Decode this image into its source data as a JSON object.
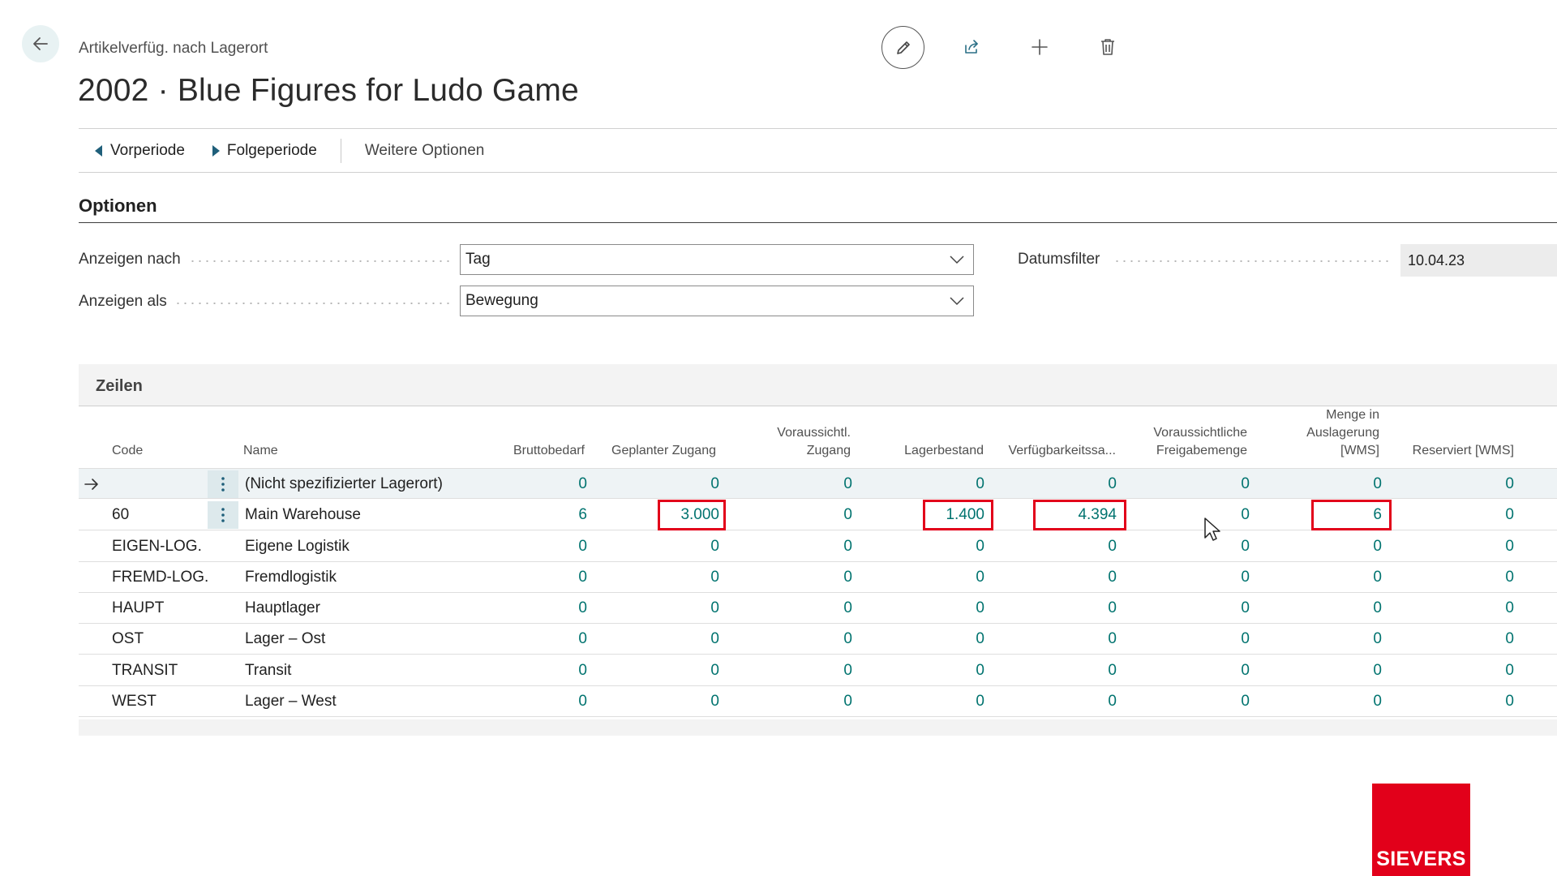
{
  "header": {
    "caption": "Artikelverfüg. nach Lagerort",
    "title": "2002 · Blue Figures for Ludo Game",
    "toolbar_icons": [
      "edit-icon",
      "share-icon",
      "plus-icon",
      "trash-icon"
    ]
  },
  "actions": {
    "prev_label": "Vorperiode",
    "next_label": "Folgeperiode",
    "more_label": "Weitere Optionen"
  },
  "options": {
    "section_title": "Optionen",
    "show_by_label": "Anzeigen nach",
    "show_by_value": "Tag",
    "show_as_label": "Anzeigen als",
    "show_as_value": "Bewegung",
    "date_filter_label": "Datumsfilter",
    "date_filter_value": "10.04.23"
  },
  "lines": {
    "title": "Zeilen",
    "columns": {
      "code": "Code",
      "name": "Name",
      "gross": "Bruttobedarf",
      "planned": "Geplanter Zugang",
      "expected_1": "Voraussichtl.",
      "expected_2": "Zugang",
      "inventory": "Lagerbestand",
      "available": "Verfügbarkeitssa...",
      "release_1": "Voraussichtliche",
      "release_2": "Freigabemenge",
      "pick_1": "Menge in",
      "pick_2": "Auslagerung",
      "pick_3": "[WMS]",
      "reserved": "Reserviert [WMS]"
    },
    "rows": [
      {
        "code": "",
        "name": "(Nicht spezifizierter Lagerort)",
        "gross": "0",
        "planned": "0",
        "expected": "0",
        "inventory": "0",
        "available": "0",
        "release": "0",
        "pick": "0",
        "reserved": "0"
      },
      {
        "code": "60",
        "name": "Main Warehouse",
        "gross": "6",
        "planned": "3.000",
        "expected": "0",
        "inventory": "1.400",
        "available": "4.394",
        "release": "0",
        "pick": "6",
        "reserved": "0"
      },
      {
        "code": "EIGEN-LOG.",
        "name": "Eigene Logistik",
        "gross": "0",
        "planned": "0",
        "expected": "0",
        "inventory": "0",
        "available": "0",
        "release": "0",
        "pick": "0",
        "reserved": "0"
      },
      {
        "code": "FREMD-LOG.",
        "name": "Fremdlogistik",
        "gross": "0",
        "planned": "0",
        "expected": "0",
        "inventory": "0",
        "available": "0",
        "release": "0",
        "pick": "0",
        "reserved": "0"
      },
      {
        "code": "HAUPT",
        "name": "Hauptlager",
        "gross": "0",
        "planned": "0",
        "expected": "0",
        "inventory": "0",
        "available": "0",
        "release": "0",
        "pick": "0",
        "reserved": "0"
      },
      {
        "code": "OST",
        "name": "Lager – Ost",
        "gross": "0",
        "planned": "0",
        "expected": "0",
        "inventory": "0",
        "available": "0",
        "release": "0",
        "pick": "0",
        "reserved": "0"
      },
      {
        "code": "TRANSIT",
        "name": "Transit",
        "gross": "0",
        "planned": "0",
        "expected": "0",
        "inventory": "0",
        "available": "0",
        "release": "0",
        "pick": "0",
        "reserved": "0"
      },
      {
        "code": "WEST",
        "name": "Lager – West",
        "gross": "0",
        "planned": "0",
        "expected": "0",
        "inventory": "0",
        "available": "0",
        "release": "0",
        "pick": "0",
        "reserved": "0"
      }
    ]
  },
  "logo": {
    "text": "SIEVERS"
  },
  "colors": {
    "accent_teal": "#00736f",
    "highlight_red": "#e2001a",
    "brand_red": "#e2001a"
  }
}
